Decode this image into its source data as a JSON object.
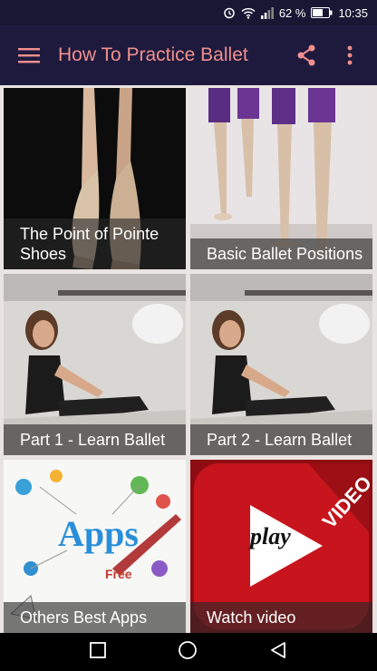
{
  "status": {
    "battery_percent": "62 %",
    "time": "10:35"
  },
  "toolbar": {
    "title": "How To Practice Ballet",
    "menu_icon": "hamburger-menu-icon",
    "share_icon": "share-icon",
    "more_icon": "more-vertical-icon"
  },
  "tiles": [
    {
      "caption": "The Point of Pointe Shoes"
    },
    {
      "caption": "Basic Ballet Positions"
    },
    {
      "caption": "Part 1 - Learn Ballet"
    },
    {
      "caption": "Part 2 - Learn Ballet"
    },
    {
      "caption": "Others Best Apps",
      "art_text": "Apps",
      "art_subtext": "Free"
    },
    {
      "caption": "Watch video",
      "art_text": "play",
      "art_banner": "VIDEO"
    }
  ],
  "colors": {
    "appbar_bg": "#1e1a3e",
    "title_color": "#f0908e",
    "video_red": "#c8141c"
  },
  "navbar": {
    "back_icon": "back-triangle-icon",
    "home_icon": "home-circle-icon",
    "recents_icon": "recents-square-icon"
  }
}
